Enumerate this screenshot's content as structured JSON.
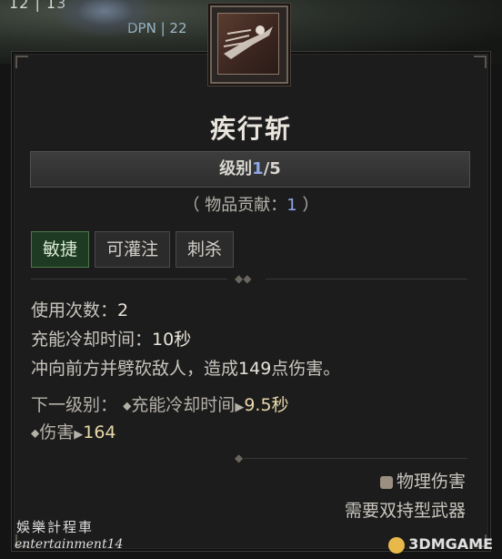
{
  "hud": {
    "top_text": "12  |  13",
    "dpn": "DPN | 22"
  },
  "skill": {
    "icon": "dash-slash-icon",
    "name": "疾行斩",
    "rank_label": "级别",
    "rank_current": "1",
    "rank_max": "/5",
    "contrib_prefix": "（ 物品贡献：",
    "contrib_value": "1",
    "contrib_suffix": " ）",
    "tags": [
      "敏捷",
      "可灌注",
      "刺杀"
    ],
    "stats": {
      "charges_label": "使用次数：",
      "charges_value": "2",
      "cooldown_label": "充能冷却时间：",
      "cooldown_value": "10秒",
      "desc_prefix": "冲向前方并劈砍敌人，造成",
      "desc_value": "149",
      "desc_suffix": "点伤害。"
    },
    "next_rank": {
      "label": "下一级别：",
      "bullet1_label": "充能冷却时间",
      "bullet1_value": "9.5秒",
      "bullet2_label": "伤害",
      "bullet2_value": "164"
    },
    "damage_type": "物理伤害",
    "requirement": "需要双持型武器"
  },
  "watermarks": {
    "cn": "娛樂計程車",
    "en": "entertainment14",
    "site": "3DMGAME"
  },
  "colors": {
    "accent_blue": "#8ea7e6",
    "tag_active": "#1e3a22"
  }
}
